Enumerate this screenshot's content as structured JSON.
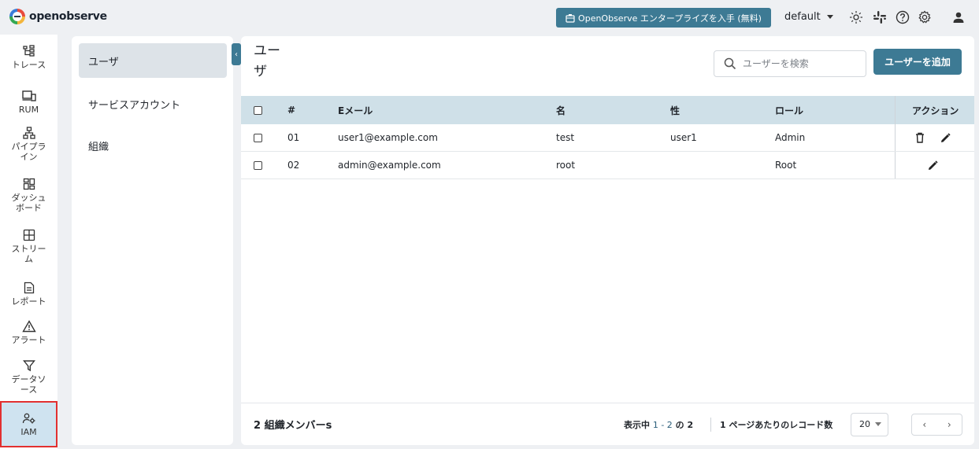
{
  "app": {
    "logo_text": "openobserve"
  },
  "topbar": {
    "enterprise_label": "OpenObserve エンタープライズを入手 (無料)",
    "org": "default",
    "icons": [
      "sun-icon",
      "slack-icon",
      "help-icon",
      "settings-icon",
      "user-icon"
    ]
  },
  "leftnav": {
    "items": [
      {
        "label": "トレース",
        "icon": "traces-icon"
      },
      {
        "label": "RUM",
        "icon": "rum-icon"
      },
      {
        "label": "パイプラ\nイン",
        "icon": "pipeline-icon"
      },
      {
        "label": "ダッシュ\nボード",
        "icon": "dashboard-icon"
      },
      {
        "label": "ストリー\nム",
        "icon": "stream-icon"
      },
      {
        "label": "レポート",
        "icon": "report-icon"
      },
      {
        "label": "アラート",
        "icon": "alert-icon"
      },
      {
        "label": "データソ\nース",
        "icon": "filter-icon"
      },
      {
        "label": "IAM",
        "icon": "iam-icon",
        "active": true
      }
    ]
  },
  "subnav": {
    "items": [
      {
        "label": "ユーザ",
        "active": true
      },
      {
        "label": "サービスアカウント"
      },
      {
        "label": "組織"
      }
    ]
  },
  "main": {
    "title": "ユーザ",
    "search_placeholder": "ユーザーを検索",
    "add_button": "ユーザーを追加",
    "columns": [
      "#",
      "Eメール",
      "名",
      "性",
      "ロール",
      "アクション"
    ],
    "rows": [
      {
        "num": "01",
        "email": "user1@example.com",
        "first": "test",
        "last": "user1",
        "role": "Admin",
        "actions": [
          "delete-icon",
          "edit-icon"
        ]
      },
      {
        "num": "02",
        "email": "admin@example.com",
        "first": "root",
        "last": "",
        "role": "Root",
        "actions": [
          "edit-icon"
        ]
      }
    ],
    "footer": {
      "members": "2 組織メンバーs",
      "showing_prefix": "表示中",
      "showing_range": "1 - 2",
      "showing_of": "の",
      "showing_total": "2",
      "per_page_label": "1 ページあたりのレコード数",
      "per_page_value": "20"
    }
  },
  "colors": {
    "accent": "#3d7a94",
    "header_bg": "#cfe0e8",
    "active_nav": "#cfe3f0"
  }
}
